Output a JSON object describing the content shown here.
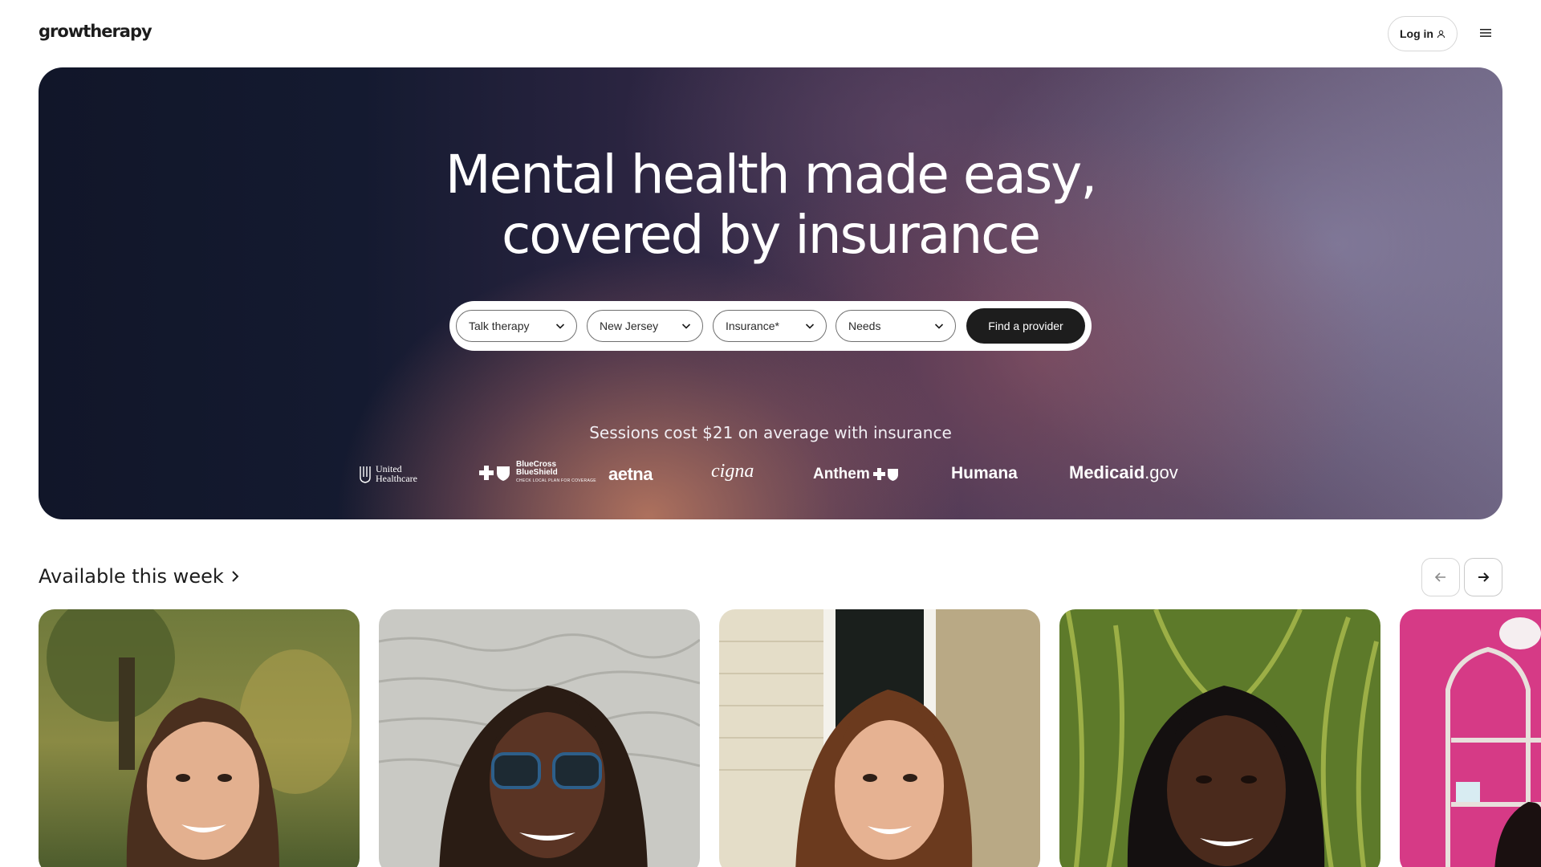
{
  "header": {
    "logo": "growtherapy",
    "login_label": "Log in",
    "user_icon": "user-icon",
    "menu_icon": "hamburger-menu-icon"
  },
  "hero": {
    "title_line1": "Mental health made easy,",
    "title_line2": "covered by insurance",
    "search": {
      "therapy_type": "Talk therapy",
      "state": "New Jersey",
      "insurance": "Insurance*",
      "needs": "Needs",
      "find_button": "Find a provider"
    },
    "sessions_text": "Sessions cost $21 on average with insurance",
    "insurers": {
      "uh_line1": "United",
      "uh_line2": "Healthcare",
      "bcbs_line1": "BlueCross",
      "bcbs_line2": "BlueShield",
      "bcbs_sub": "CHECK LOCAL PLAN FOR COVERAGE",
      "aetna": "aetna",
      "cigna": "cigna",
      "anthem": "Anthem",
      "humana": "Humana",
      "medicaid_bold": "Medicaid",
      "medicaid_light": ".gov"
    }
  },
  "available": {
    "title": "Available this week",
    "prev_icon": "arrow-left-icon",
    "next_icon": "arrow-right-icon"
  },
  "colors": {
    "hero_dark": "#111629",
    "hero_light": "#6f6684",
    "button_dark": "#1d1d1d",
    "card_pink": "#d63a86"
  }
}
